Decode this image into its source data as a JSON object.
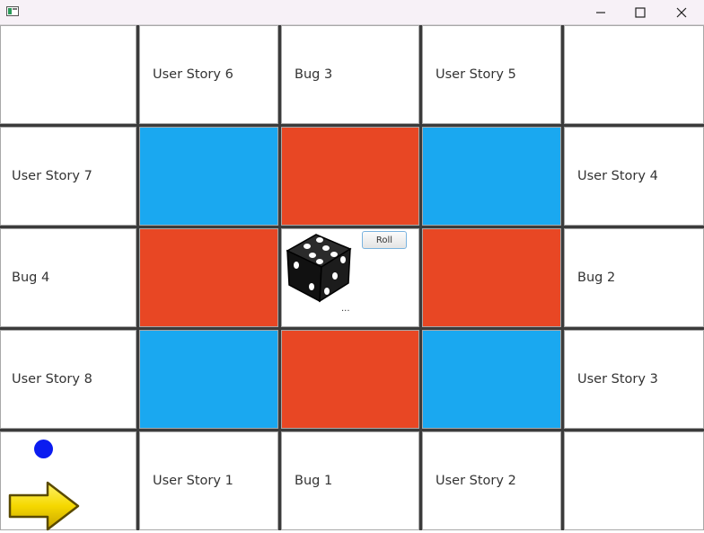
{
  "window": {
    "icons": [
      "app-icon",
      "minimize-icon",
      "maximize-icon",
      "close-icon"
    ]
  },
  "board": {
    "colors": {
      "blue": "#1aa8f0",
      "red": "#e84724",
      "grid": "#3b3b3b",
      "cell": "#ffffff"
    },
    "row1": [
      "",
      "User Story 6",
      "Bug 3",
      "User Story 5",
      ""
    ],
    "row2": [
      "User Story 7",
      "",
      "",
      "",
      "User Story 4"
    ],
    "row3": [
      "Bug 4",
      "",
      "",
      "",
      "Bug 2"
    ],
    "row4": [
      "User Story 8",
      "",
      "",
      "",
      "User Story 3"
    ],
    "row5": [
      "",
      "User Story 1",
      "Bug 1",
      "User Story 2",
      ""
    ]
  },
  "dice": {
    "roll_label": "Roll",
    "status": "...",
    "icon": "dice-icon"
  },
  "player": {
    "token_color": "#0b1cf0",
    "start_icon": "arrow-right-icon"
  }
}
